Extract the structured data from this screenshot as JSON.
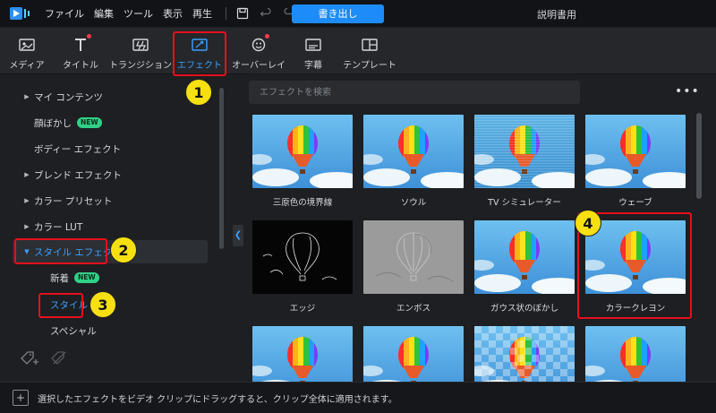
{
  "menubar": {
    "items": [
      "ファイル",
      "編集",
      "ツール",
      "表示",
      "再生"
    ],
    "export_label": "書き出し",
    "doc_title": "説明書用"
  },
  "tabs": [
    {
      "id": "media",
      "label": "メディア",
      "icon": "media-icon",
      "active": false,
      "dot": false
    },
    {
      "id": "title",
      "label": "タイトル",
      "icon": "title-icon",
      "active": false,
      "dot": true
    },
    {
      "id": "transition",
      "label": "トランジション",
      "icon": "transition-icon",
      "active": false,
      "dot": false
    },
    {
      "id": "effect",
      "label": "エフェクト",
      "icon": "effect-icon",
      "active": true,
      "dot": false
    },
    {
      "id": "overlay",
      "label": "オーバーレイ",
      "icon": "overlay-icon",
      "active": false,
      "dot": true
    },
    {
      "id": "subtitle",
      "label": "字幕",
      "icon": "subtitle-icon",
      "active": false,
      "dot": false
    },
    {
      "id": "template",
      "label": "テンプレート",
      "icon": "template-icon",
      "active": false,
      "dot": false
    }
  ],
  "sidebar": {
    "items": [
      {
        "label": "マイ コンテンツ",
        "arrow": "right",
        "level": 0,
        "badge": ""
      },
      {
        "label": "顔ぼかし",
        "arrow": "",
        "level": 1,
        "badge": "NEW"
      },
      {
        "label": "ボディー エフェクト",
        "arrow": "",
        "level": 1,
        "badge": ""
      },
      {
        "label": "ブレンド エフェクト",
        "arrow": "right",
        "level": 0,
        "badge": ""
      },
      {
        "label": "カラー プリセット",
        "arrow": "right",
        "level": 0,
        "badge": ""
      },
      {
        "label": "カラー LUT",
        "arrow": "right",
        "level": 0,
        "badge": ""
      },
      {
        "label": "スタイル エフェクト",
        "arrow": "down",
        "level": 0,
        "badge": "",
        "selected": true
      },
      {
        "label": "新着",
        "arrow": "",
        "level": 2,
        "badge": "NEW"
      },
      {
        "label": "スタイル",
        "arrow": "",
        "level": 2,
        "badge": "",
        "highlighted": true
      },
      {
        "label": "スペシャル",
        "arrow": "",
        "level": 2,
        "badge": ""
      }
    ]
  },
  "search": {
    "placeholder": "エフェクトを検索"
  },
  "effects": [
    {
      "label": "三原色の境界線",
      "style": "normal"
    },
    {
      "label": "ソウル",
      "style": "normal"
    },
    {
      "label": "TV シミュレーター",
      "style": "tv"
    },
    {
      "label": "ウェーブ",
      "style": "normal"
    },
    {
      "label": "エッジ",
      "style": "edge"
    },
    {
      "label": "エンボス",
      "style": "emboss"
    },
    {
      "label": "ガウス状のぼかし",
      "style": "normal"
    },
    {
      "label": "カラークレヨン",
      "style": "normal"
    },
    {
      "label": "",
      "style": "normal"
    },
    {
      "label": "",
      "style": "normal"
    },
    {
      "label": "",
      "style": "pixel"
    },
    {
      "label": "",
      "style": "normal"
    }
  ],
  "status": {
    "text": "選択したエフェクトをビデオ クリップにドラッグすると、クリップ全体に適用されます。"
  },
  "callouts": [
    "1",
    "2",
    "3",
    "4"
  ],
  "colors": {
    "accent": "#1d8cf8",
    "highlight": "#e5101c",
    "callout": "#f7e010",
    "new_badge": "#2fd187"
  }
}
